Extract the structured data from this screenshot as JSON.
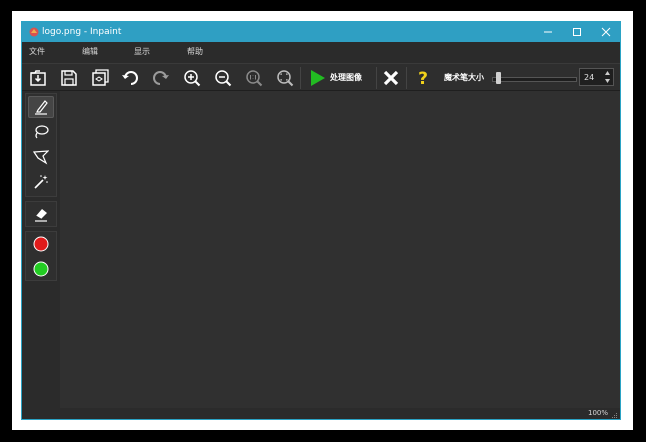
{
  "window": {
    "title": "logo.png - Inpaint",
    "controls": [
      "minimize",
      "maximize",
      "close"
    ]
  },
  "menu": {
    "items": [
      {
        "label": "文件"
      },
      {
        "label": "编辑"
      },
      {
        "label": "显示"
      },
      {
        "label": "帮助"
      }
    ]
  },
  "toolbar": {
    "icons": [
      "open-icon",
      "save-icon",
      "save-as-icon",
      "undo-icon",
      "redo-icon",
      "zoom-in-icon",
      "zoom-out-icon",
      "zoom-actual-icon",
      "zoom-fit-icon"
    ],
    "process_label": "处理图像",
    "brush_size_label": "魔术笔大小",
    "brush_size_value": "24",
    "brush_size_fraction": 0.05
  },
  "sidebar": {
    "tools": [
      "marker-icon",
      "lasso-icon",
      "polygon-lasso-icon",
      "magic-wand-icon",
      "eraser-icon",
      "red-dot-icon",
      "green-dot-icon"
    ],
    "colors": {
      "red": "#e01b1b",
      "green": "#22cc22"
    }
  },
  "status": {
    "zoom": "100%"
  },
  "colors": {
    "titlebar": "#2f9fc3",
    "process_green": "#22bb22",
    "help_yellow": "#f2d21b"
  }
}
